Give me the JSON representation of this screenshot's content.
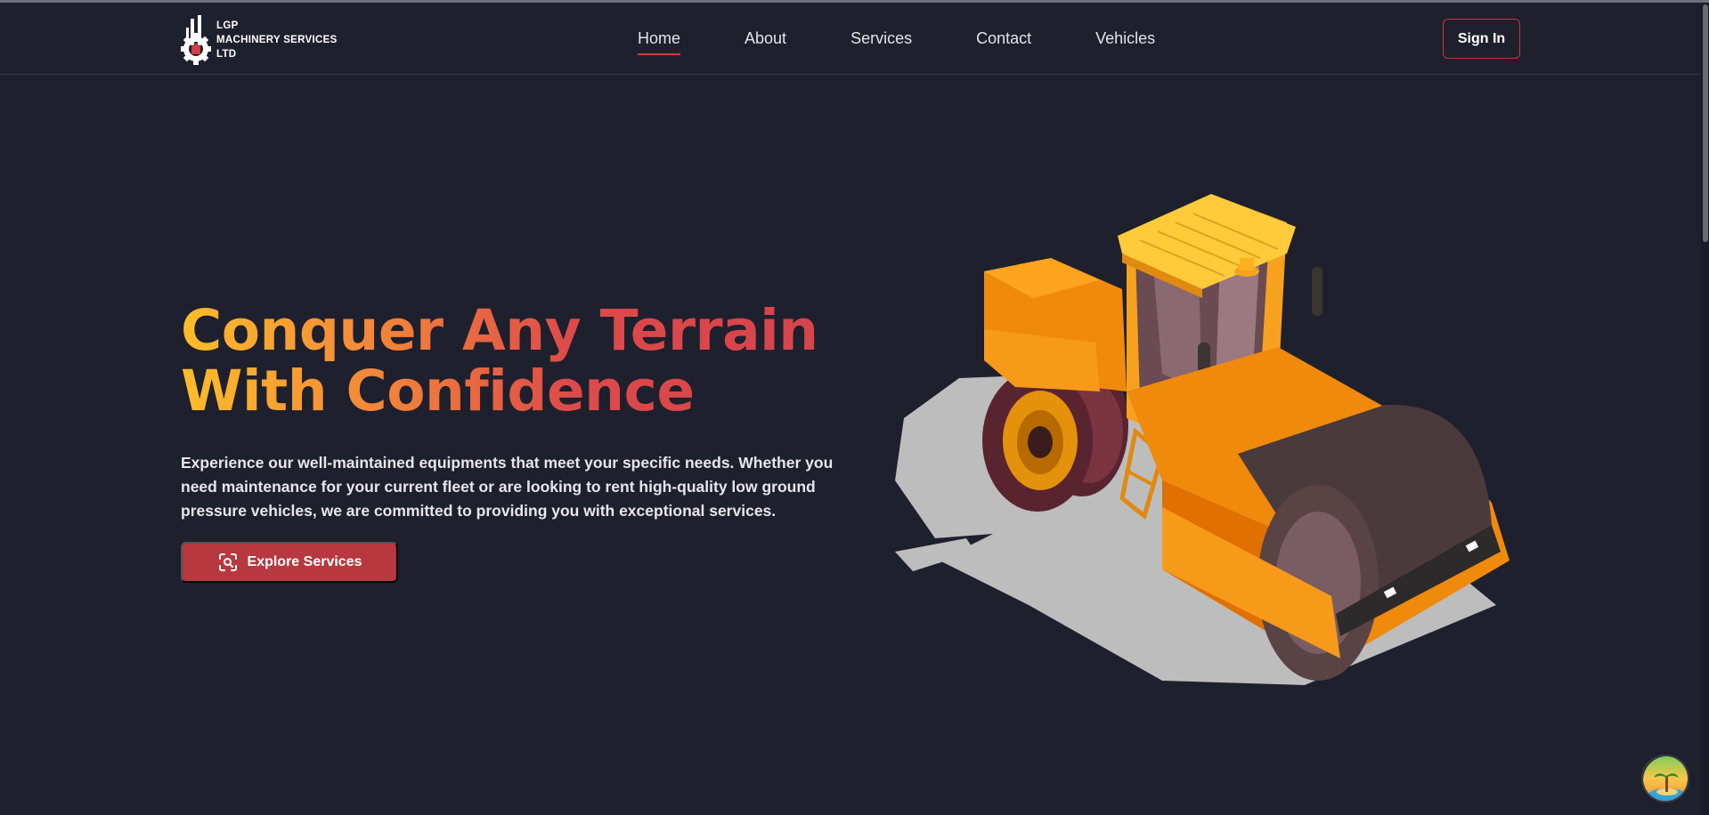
{
  "brand": {
    "lines": [
      "LGP",
      "MACHINERY SERVICES",
      "LTD"
    ],
    "logo_icon": "gear-logo-icon"
  },
  "nav": {
    "items": [
      {
        "label": "Home",
        "active": true
      },
      {
        "label": "About",
        "active": false
      },
      {
        "label": "Services",
        "active": false
      },
      {
        "label": "Contact",
        "active": false
      },
      {
        "label": "Vehicles",
        "active": false
      }
    ],
    "signin_label": "Sign In"
  },
  "hero": {
    "title_line1": "Conquer Any Terrain",
    "title_line2": "With Confidence",
    "description": "Experience our well-maintained equipments that meet your specific needs. Whether you need maintenance for your current fleet or are looking to rent high-quality low ground pressure vehicles, we are committed to providing you with exceptional services.",
    "cta_label": "Explore Services",
    "cta_icon": "scan-search-icon",
    "illustration": "road-roller-illustration"
  },
  "colors": {
    "background": "#1f202d",
    "accent": "#b8383f",
    "gradient": [
      "#fcbd2a",
      "#f2843a",
      "#dd4a4a",
      "#d4434c"
    ]
  },
  "floating_button_icon": "island-avatar-icon"
}
